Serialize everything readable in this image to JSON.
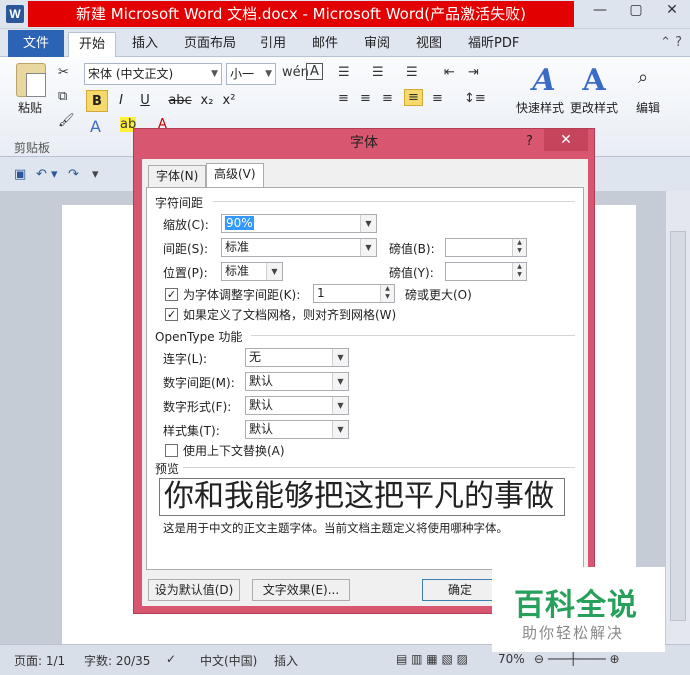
{
  "window": {
    "app_icon": "W",
    "title": "新建 Microsoft Word 文档.docx - Microsoft Word(产品激活失败)",
    "minimize": "—",
    "maximize": "▢",
    "close": "✕"
  },
  "ribbon_tabs": {
    "file": "文件",
    "items": [
      "开始",
      "插入",
      "页面布局",
      "引用",
      "邮件",
      "审阅",
      "视图",
      "福昕PDF"
    ]
  },
  "ribbon": {
    "paste_label": "粘贴",
    "clipboard_group": "剪贴板",
    "font_name": "宋体 (中文正文)",
    "font_size": "小一",
    "bold": "B",
    "italic": "I",
    "underline": "U",
    "strike": "abc",
    "subscript": "x₂",
    "superscript": "x²",
    "quick_styles": "快速样式",
    "change_styles": "更改样式",
    "editing": "编辑"
  },
  "qat": {
    "save_icon": "save-icon",
    "undo_icon": "undo-icon",
    "redo_icon": "redo-icon"
  },
  "dialog": {
    "title": "字体",
    "help": "?",
    "close": "✕",
    "tabs": [
      "字体(N)",
      "高级(V)"
    ],
    "char_spacing_section": "字符间距",
    "scale_label": "缩放(C):",
    "scale_value": "90%",
    "spacing_label": "间距(S):",
    "spacing_value": "标准",
    "spacing_by_label": "磅值(B):",
    "spacing_by_value": "",
    "position_label": "位置(P):",
    "position_value": "标准",
    "position_by_label": "磅值(Y):",
    "position_by_value": "",
    "kerning_label": "为字体调整字间距(K):",
    "kerning_value": "1",
    "kerning_suffix": "磅或更大(O)",
    "grid_label": "如果定义了文档网格，则对齐到网格(W)",
    "opentype_section": "OpenType 功能",
    "ligatures_label": "连字(L):",
    "ligatures_value": "无",
    "number_spacing_label": "数字间距(M):",
    "number_spacing_value": "默认",
    "number_forms_label": "数字形式(F):",
    "number_forms_value": "默认",
    "stylistic_sets_label": "样式集(T):",
    "stylistic_sets_value": "默认",
    "contextual_label": "使用上下文替换(A)",
    "preview_section": "预览",
    "preview_text": "你和我能够把这把平凡的事做",
    "preview_note": "这是用于中文的正文主题字体。当前文档主题定义将使用哪种字体。",
    "set_default": "设为默认值(D)",
    "text_effects": "文字效果(E)...",
    "ok": "确定"
  },
  "statusbar": {
    "page": "页面: 1/1",
    "words": "字数: 20/35",
    "language": "中文(中国)",
    "mode": "插入",
    "zoom": "70%"
  },
  "watermark": {
    "main": "百科全说",
    "sub": "助你轻松解决"
  }
}
